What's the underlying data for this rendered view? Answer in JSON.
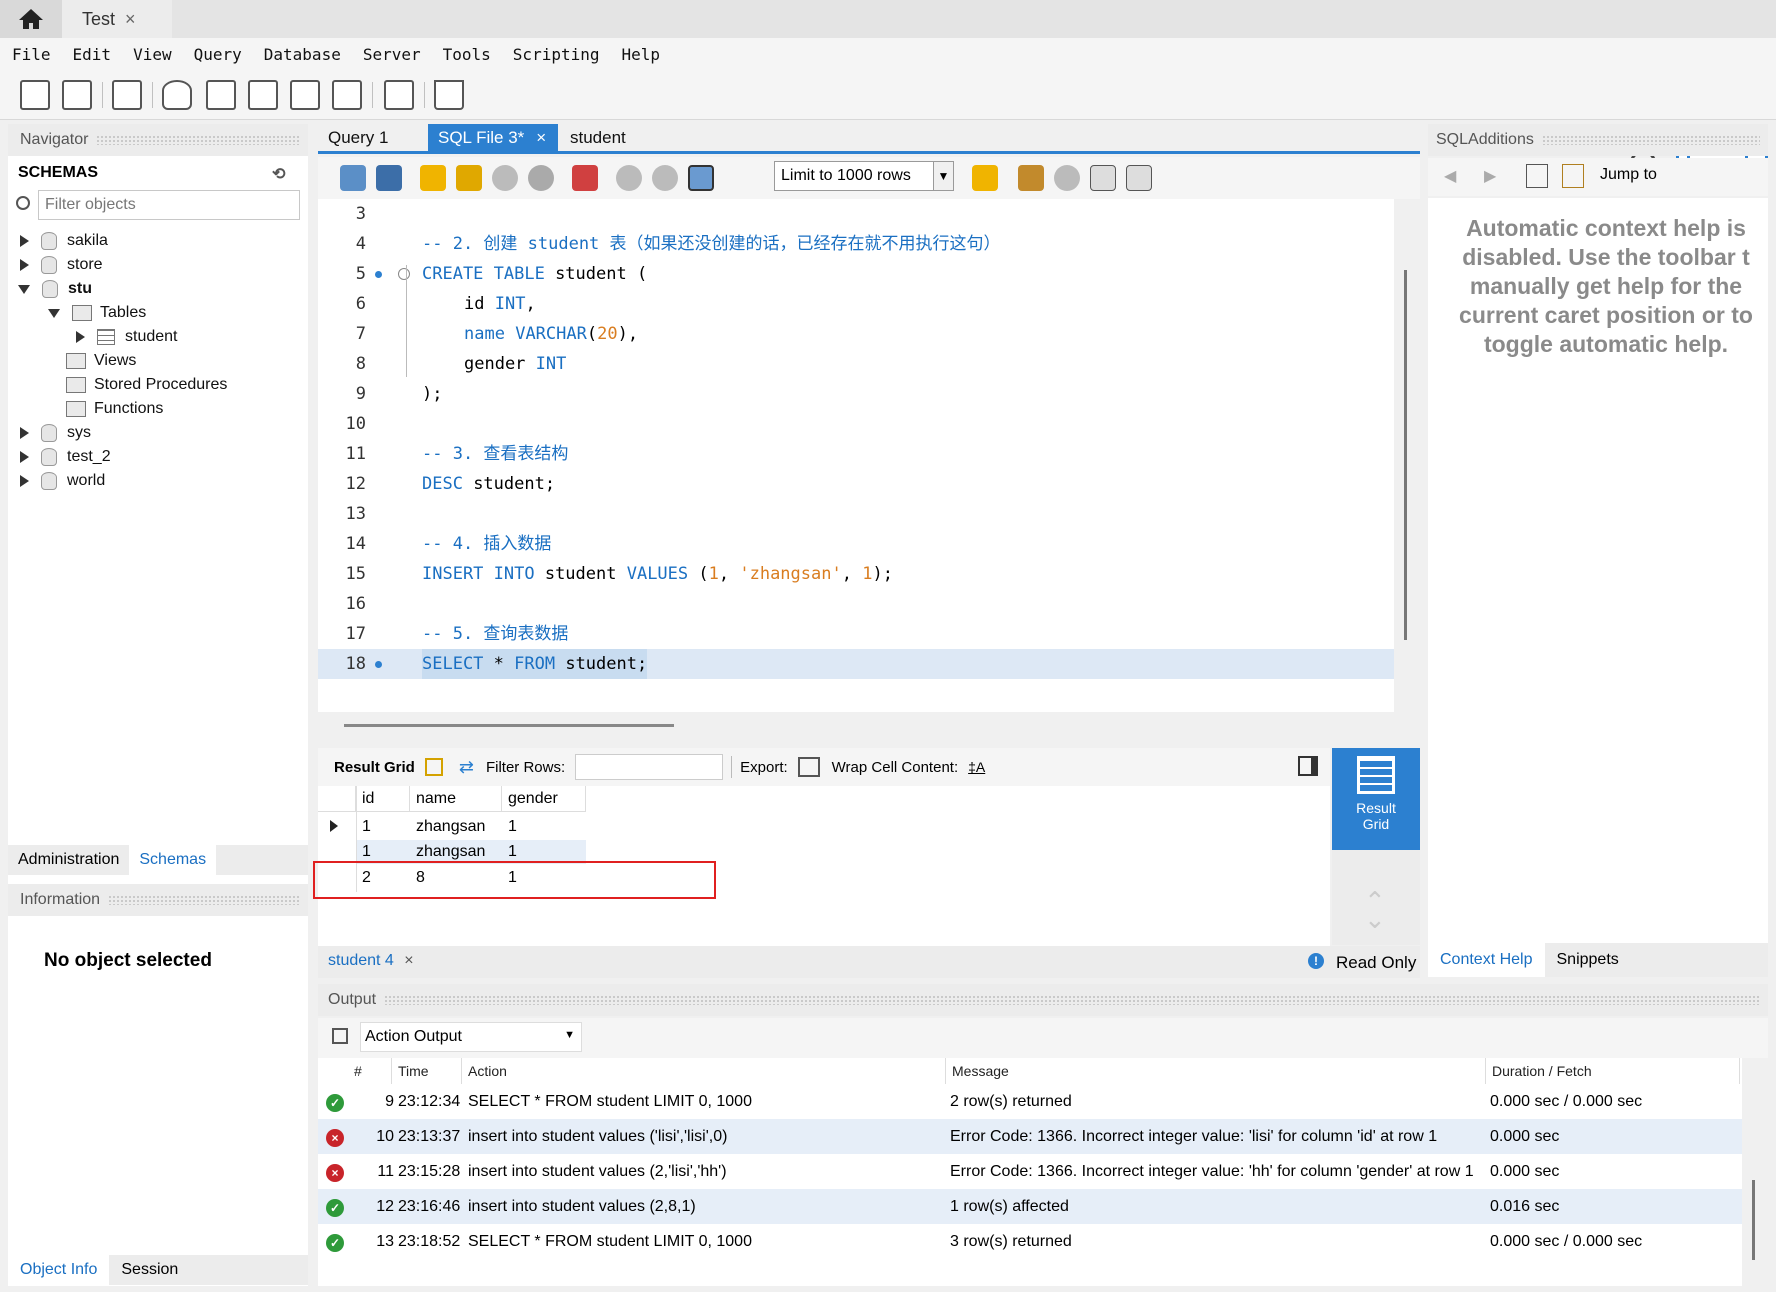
{
  "window": {
    "connection_tab": "Test",
    "close_glyph": "×"
  },
  "menu": [
    "File",
    "Edit",
    "View",
    "Query",
    "Database",
    "Server",
    "Tools",
    "Scripting",
    "Help"
  ],
  "navigator": {
    "title": "Navigator",
    "schemas_label": "SCHEMAS",
    "filter_placeholder": "Filter objects",
    "tree": {
      "sakila": "sakila",
      "store": "store",
      "stu": "stu",
      "tables": "Tables",
      "student": "student",
      "views": "Views",
      "procedures": "Stored Procedures",
      "functions": "Functions",
      "sys": "sys",
      "test_2": "test_2",
      "world": "world"
    },
    "tabs": [
      "Administration",
      "Schemas"
    ],
    "information_title": "Information",
    "no_object": "No object selected",
    "bottom_tabs": [
      "Object Info",
      "Session"
    ]
  },
  "editor": {
    "tabs": [
      "Query 1",
      "SQL File 3*",
      "student"
    ],
    "limit_select": "Limit to 1000 rows",
    "lines": [
      {
        "n": "3"
      },
      {
        "n": "4",
        "comment": "-- 2. 创建 student 表（如果还没创建的话，已经存在就不用执行这句）"
      },
      {
        "n": "5",
        "kw1": "CREATE TABLE",
        "rest": " student ("
      },
      {
        "n": "6",
        "ident": "id",
        "kw": "INT",
        "tail": ","
      },
      {
        "n": "7",
        "ident": "name",
        "kw": "VARCHAR",
        "num": "20",
        "tail": "),"
      },
      {
        "n": "8",
        "ident": "gender",
        "kw": "INT"
      },
      {
        "n": "9",
        "text": ");"
      },
      {
        "n": "10"
      },
      {
        "n": "11",
        "comment": "-- 3. 查看表结构"
      },
      {
        "n": "12",
        "kw1": "DESC",
        "rest": " student;"
      },
      {
        "n": "13"
      },
      {
        "n": "14",
        "comment": "-- 4. 插入数据"
      },
      {
        "n": "15",
        "kw1": "INSERT INTO",
        "rest": " student ",
        "kw2": "VALUES",
        "v1": "1",
        "v2": "'zhangsan'",
        "v3": "1"
      },
      {
        "n": "16"
      },
      {
        "n": "17",
        "comment": "-- 5. 查询表数据"
      },
      {
        "n": "18",
        "kw1": "SELECT",
        "rest": " * ",
        "kw2": "FROM",
        "rest2": " student;"
      }
    ]
  },
  "result": {
    "toolbar": {
      "grid_label": "Result Grid",
      "filter_label": "Filter Rows:",
      "export_label": "Export:",
      "wrap_label": "Wrap Cell Content:"
    },
    "columns": [
      "id",
      "name",
      "gender"
    ],
    "rows": [
      [
        "1",
        "zhangsan",
        "1"
      ],
      [
        "1",
        "zhangsan",
        "1"
      ],
      [
        "2",
        "8",
        "1"
      ]
    ],
    "side_label_1": "Result",
    "side_label_2": "Grid",
    "tab": "student 4",
    "read_only": "Read Only"
  },
  "sql_additions": {
    "title": "SQLAdditions",
    "jump_to": "Jump to",
    "help_text": "Automatic context help is disabled. Use the toolbar t manually get help for the current caret position or to toggle automatic help.",
    "tabs": [
      "Context Help",
      "Snippets"
    ]
  },
  "output": {
    "title": "Output",
    "select": "Action Output",
    "columns": [
      "#",
      "Time",
      "Action",
      "Message",
      "Duration / Fetch"
    ],
    "rows": [
      {
        "status": "ok",
        "n": "9",
        "time": "23:12:34",
        "action": "SELECT * FROM student LIMIT 0, 1000",
        "message": "2 row(s) returned",
        "duration": "0.000 sec / 0.000 sec"
      },
      {
        "status": "error",
        "n": "10",
        "time": "23:13:37",
        "action": "insert into student values ('lisi','lisi',0)",
        "message": "Error Code: 1366. Incorrect integer value: 'lisi' for column 'id' at row 1",
        "duration": "0.000 sec"
      },
      {
        "status": "error",
        "n": "11",
        "time": "23:15:28",
        "action": "insert into student values (2,'lisi','hh')",
        "message": "Error Code: 1366. Incorrect integer value: 'hh' for column 'gender' at row 1",
        "duration": "0.000 sec"
      },
      {
        "status": "ok",
        "n": "12",
        "time": "23:16:46",
        "action": "insert into student values (2,8,1)",
        "message": "1 row(s) affected",
        "duration": "0.016 sec"
      },
      {
        "status": "ok",
        "n": "13",
        "time": "23:18:52",
        "action": "SELECT * FROM student LIMIT 0, 1000",
        "message": "3 row(s) returned",
        "duration": "0.000 sec / 0.000 sec"
      }
    ]
  },
  "colors": {
    "accent": "#2c80d0",
    "highlight": "#e02020",
    "ok": "#2e9a3a",
    "error": "#c8242a"
  }
}
